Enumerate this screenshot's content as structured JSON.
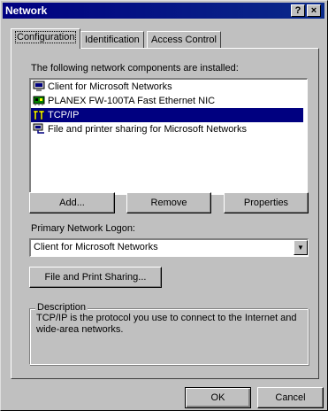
{
  "window": {
    "title": "Network"
  },
  "titlebar": {
    "help_glyph": "?",
    "close_glyph": "×"
  },
  "tabs": [
    {
      "label": "Configuration",
      "active": true
    },
    {
      "label": "Identification",
      "active": false
    },
    {
      "label": "Access Control",
      "active": false
    }
  ],
  "components": {
    "heading": "The following network components are installed:",
    "items": [
      {
        "label": "Client for Microsoft Networks",
        "icon": "network-client-icon",
        "selected": false
      },
      {
        "label": "PLANEX FW-100TA Fast Ethernet NIC",
        "icon": "network-adapter-icon",
        "selected": false
      },
      {
        "label": "TCP/IP",
        "icon": "protocol-icon",
        "selected": true
      },
      {
        "label": "File and printer sharing for Microsoft Networks",
        "icon": "service-icon",
        "selected": false
      }
    ]
  },
  "buttons": {
    "add": "Add...",
    "remove": "Remove",
    "properties": "Properties",
    "file_print_sharing": "File and Print Sharing...",
    "ok": "OK",
    "cancel": "Cancel"
  },
  "logon": {
    "label": "Primary Network Logon:",
    "value": "Client for Microsoft Networks"
  },
  "description": {
    "title": "Description",
    "text": "TCP/IP is the protocol you use to connect to the Internet and wide-area networks."
  },
  "colors": {
    "titlebar": "#000080",
    "selection": "#000080",
    "face": "#c0c0c0"
  }
}
